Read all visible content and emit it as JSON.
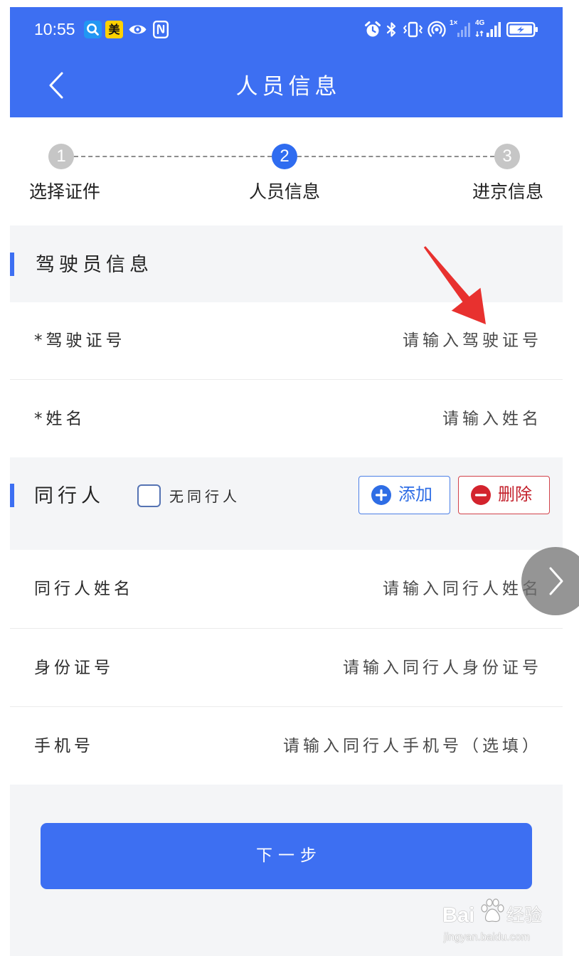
{
  "theme": {
    "primary": "#3d6ff2",
    "page_background": "#f4f5f7",
    "card_background": "#ffffff",
    "step_inactive": "#c6c6c6",
    "danger": "#c8252f",
    "annotation": "#e8312f"
  },
  "status_bar": {
    "time": "10:55",
    "meituan_badge": "美",
    "sim1_label": "1×",
    "network_label": "4G",
    "left_icons": [
      "search-badge-icon",
      "meituan-app-icon",
      "eye-icon",
      "nfc-icon"
    ],
    "right_icons": [
      "alarm-icon",
      "bluetooth-icon",
      "vibrate-icon",
      "hotspot-icon",
      "signal-sim1-icon",
      "signal-4g-icon",
      "battery-charging-icon"
    ]
  },
  "header": {
    "back_icon": "chevron-left-icon",
    "title": "人员信息"
  },
  "steps": [
    {
      "number": "1",
      "label": "选择证件",
      "current": false
    },
    {
      "number": "2",
      "label": "人员信息",
      "current": true
    },
    {
      "number": "3",
      "label": "进京信息",
      "current": false
    }
  ],
  "driver_section": {
    "title": "驾驶员信息",
    "fields": [
      {
        "label": "*驾驶证号",
        "placeholder": "请输入驾驶证号",
        "value": ""
      },
      {
        "label": "*姓名",
        "placeholder": "请输入姓名",
        "value": ""
      }
    ]
  },
  "companion_section": {
    "title": "同行人",
    "no_companion_label": "无同行人",
    "no_companion_checked": false,
    "add_button": {
      "label": "添加",
      "icon": "plus-circle-icon"
    },
    "delete_button": {
      "label": "删除",
      "icon": "minus-circle-icon"
    },
    "fields": [
      {
        "label": "同行人姓名",
        "placeholder": "请输入同行人姓名",
        "value": ""
      },
      {
        "label": "身份证号",
        "placeholder": "请输入同行人身份证号",
        "value": ""
      },
      {
        "label": "手机号",
        "placeholder": "请输入同行人手机号（选填）",
        "value": ""
      }
    ]
  },
  "next_button": {
    "label": "下一步"
  },
  "floating_button": {
    "icon": "chevron-right-icon"
  },
  "watermark": {
    "brand_prefix": "Bai",
    "brand_icon": "paw-icon",
    "brand_suffix": "经验",
    "url": "jingyan.baidu.com"
  }
}
